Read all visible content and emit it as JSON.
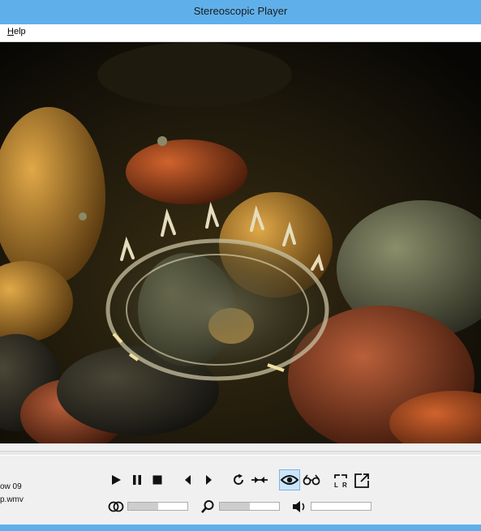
{
  "window": {
    "title": "Stereoscopic Player"
  },
  "menu": {
    "items": [
      {
        "accel": "H",
        "rest": "elp"
      }
    ]
  },
  "media": {
    "title_line": "ow 09",
    "file_line": "p.wmv"
  },
  "sliders": {
    "balance_level": 0.5,
    "zoom_level": 0.5,
    "volume_level": 0.0
  },
  "colors": {
    "titlebar": "#5fb0ea",
    "active_button": "#cce4f7"
  },
  "icons": [
    "play-icon",
    "pause-icon",
    "stop-icon",
    "previous-frame-icon",
    "next-frame-icon",
    "loop-icon",
    "swap-eyes-icon",
    "eye-icon",
    "glasses-icon",
    "left-right-icon",
    "fullscreen-icon",
    "balance-icon",
    "zoom-icon",
    "volume-icon"
  ]
}
